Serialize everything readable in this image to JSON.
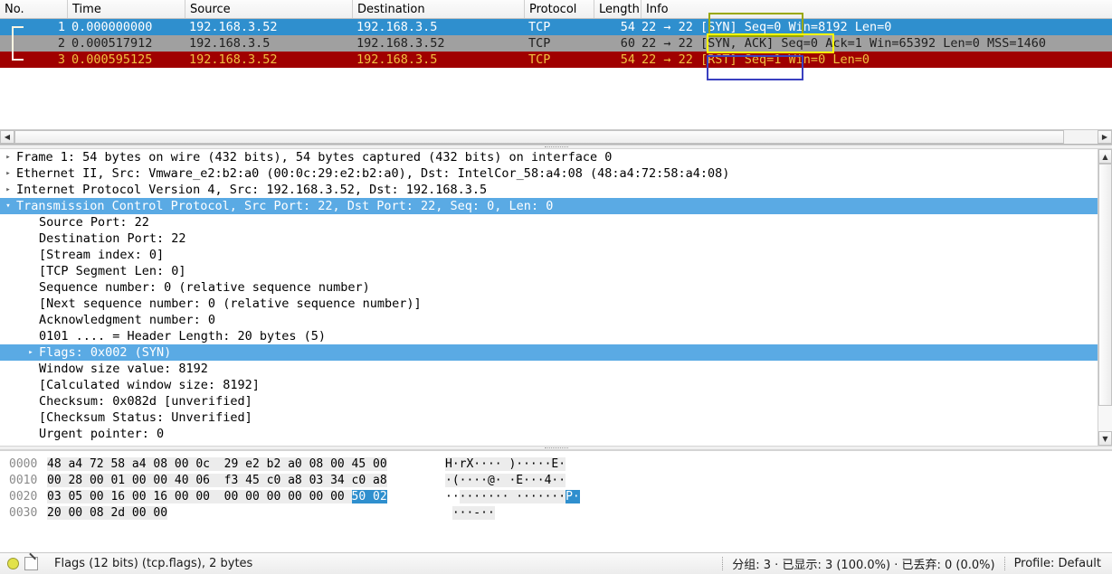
{
  "packet_list": {
    "columns": [
      "No.",
      "Time",
      "Source",
      "Destination",
      "Protocol",
      "Length",
      "Info"
    ],
    "rows": [
      {
        "no": "1",
        "time": "0.000000000",
        "source": "192.168.3.52",
        "destination": "192.168.3.5",
        "protocol": "TCP",
        "length": "54",
        "info": "22 → 22 [SYN] Seq=0 Win=8192 Len=0",
        "state": "selected"
      },
      {
        "no": "2",
        "time": "0.000517912",
        "source": "192.168.3.5",
        "destination": "192.168.3.52",
        "protocol": "TCP",
        "length": "60",
        "info": "22 → 22 [SYN, ACK] Seq=0 Ack=1 Win=65392 Len=0 MSS=1460",
        "state": "grey"
      },
      {
        "no": "3",
        "time": "0.000595125",
        "source": "192.168.3.52",
        "destination": "192.168.3.5",
        "protocol": "TCP",
        "length": "54",
        "info": "22 → 22 [RST] Seq=1 Win=0 Len=0",
        "state": "reset"
      }
    ]
  },
  "annotations": [
    {
      "name": "syn-highlight-box",
      "color": "#9aa800"
    },
    {
      "name": "syn-ack-highlight-box",
      "color": "#ffff00"
    },
    {
      "name": "rst-highlight-box",
      "color": "#3a40c0"
    }
  ],
  "detail": {
    "rows": [
      {
        "twisty": "▸",
        "indent": 0,
        "text": "Frame 1: 54 bytes on wire (432 bits), 54 bytes captured (432 bits) on interface 0",
        "highlight": false
      },
      {
        "twisty": "▸",
        "indent": 0,
        "text": "Ethernet II, Src: Vmware_e2:b2:a0 (00:0c:29:e2:b2:a0), Dst: IntelCor_58:a4:08 (48:a4:72:58:a4:08)",
        "highlight": false
      },
      {
        "twisty": "▸",
        "indent": 0,
        "text": "Internet Protocol Version 4, Src: 192.168.3.52, Dst: 192.168.3.5",
        "highlight": false
      },
      {
        "twisty": "▾",
        "indent": 0,
        "text": "Transmission Control Protocol, Src Port: 22, Dst Port: 22, Seq: 0, Len: 0",
        "highlight": true
      },
      {
        "twisty": "",
        "indent": 1,
        "text": "Source Port: 22",
        "highlight": false
      },
      {
        "twisty": "",
        "indent": 1,
        "text": "Destination Port: 22",
        "highlight": false
      },
      {
        "twisty": "",
        "indent": 1,
        "text": "[Stream index: 0]",
        "highlight": false
      },
      {
        "twisty": "",
        "indent": 1,
        "text": "[TCP Segment Len: 0]",
        "highlight": false
      },
      {
        "twisty": "",
        "indent": 1,
        "text": "Sequence number: 0    (relative sequence number)",
        "highlight": false
      },
      {
        "twisty": "",
        "indent": 1,
        "text": "[Next sequence number: 0    (relative sequence number)]",
        "highlight": false
      },
      {
        "twisty": "",
        "indent": 1,
        "text": "Acknowledgment number: 0",
        "highlight": false
      },
      {
        "twisty": "",
        "indent": 1,
        "text": "0101 .... = Header Length: 20 bytes (5)",
        "highlight": false
      },
      {
        "twisty": "▸",
        "indent": 2,
        "text": "Flags: 0x002 (SYN)",
        "highlight": true
      },
      {
        "twisty": "",
        "indent": 1,
        "text": "Window size value: 8192",
        "highlight": false
      },
      {
        "twisty": "",
        "indent": 1,
        "text": "[Calculated window size: 8192]",
        "highlight": false
      },
      {
        "twisty": "",
        "indent": 1,
        "text": "Checksum: 0x082d [unverified]",
        "highlight": false
      },
      {
        "twisty": "",
        "indent": 1,
        "text": "[Checksum Status: Unverified]",
        "highlight": false
      },
      {
        "twisty": "",
        "indent": 1,
        "text": "Urgent pointer: 0",
        "highlight": false
      }
    ]
  },
  "hex": {
    "rows": [
      {
        "offset": "0000",
        "bytes_plain_pre": "",
        "bytes_shaded": "48 a4 72 58 a4 08 00 0c  29 e2 b2 a0 08 00 45 00",
        "bytes_selected": "",
        "bytes_plain_post": "",
        "ascii_pre": "",
        "ascii_shaded": "H·rX···· )·····E·",
        "ascii_selected": "",
        "ascii_post": ""
      },
      {
        "offset": "0010",
        "bytes_plain_pre": "",
        "bytes_shaded": "00 28 00 01 00 00 40 06  f3 45 c0 a8 03 34 c0 a8",
        "bytes_selected": "",
        "bytes_plain_post": "",
        "ascii_pre": "",
        "ascii_shaded": "·(····@· ·E···4··",
        "ascii_selected": "",
        "ascii_post": ""
      },
      {
        "offset": "0020",
        "bytes_plain_pre": "",
        "bytes_shaded": "03 05 00 16 00 16 00 00  00 00 00 00 00 00 ",
        "bytes_selected": "50 02",
        "bytes_plain_post": "",
        "ascii_pre": "··",
        "ascii_shaded": "······· ·······",
        "ascii_selected": "P·",
        "ascii_post": ""
      },
      {
        "offset": "0030",
        "bytes_plain_pre": "",
        "bytes_shaded": "20 00 08 2d 00 00",
        "bytes_selected": "",
        "bytes_plain_post": "",
        "ascii_pre": " ",
        "ascii_shaded": "···-··",
        "ascii_selected": "",
        "ascii_post": ""
      }
    ]
  },
  "statusbar": {
    "field_info": "Flags (12 bits) (tcp.flags), 2 bytes",
    "counts": "分组: 3 · 已显示: 3 (100.0%) · 已丢弃: 0 (0.0%)",
    "profile": "Profile: Default",
    "expert_icon": "expert-info-dot",
    "comment_icon": "capture-comment-icon"
  },
  "scrollbars": {
    "left_arrow": "◀",
    "right_arrow": "▶",
    "up_arrow": "▲",
    "down_arrow": "▼"
  }
}
